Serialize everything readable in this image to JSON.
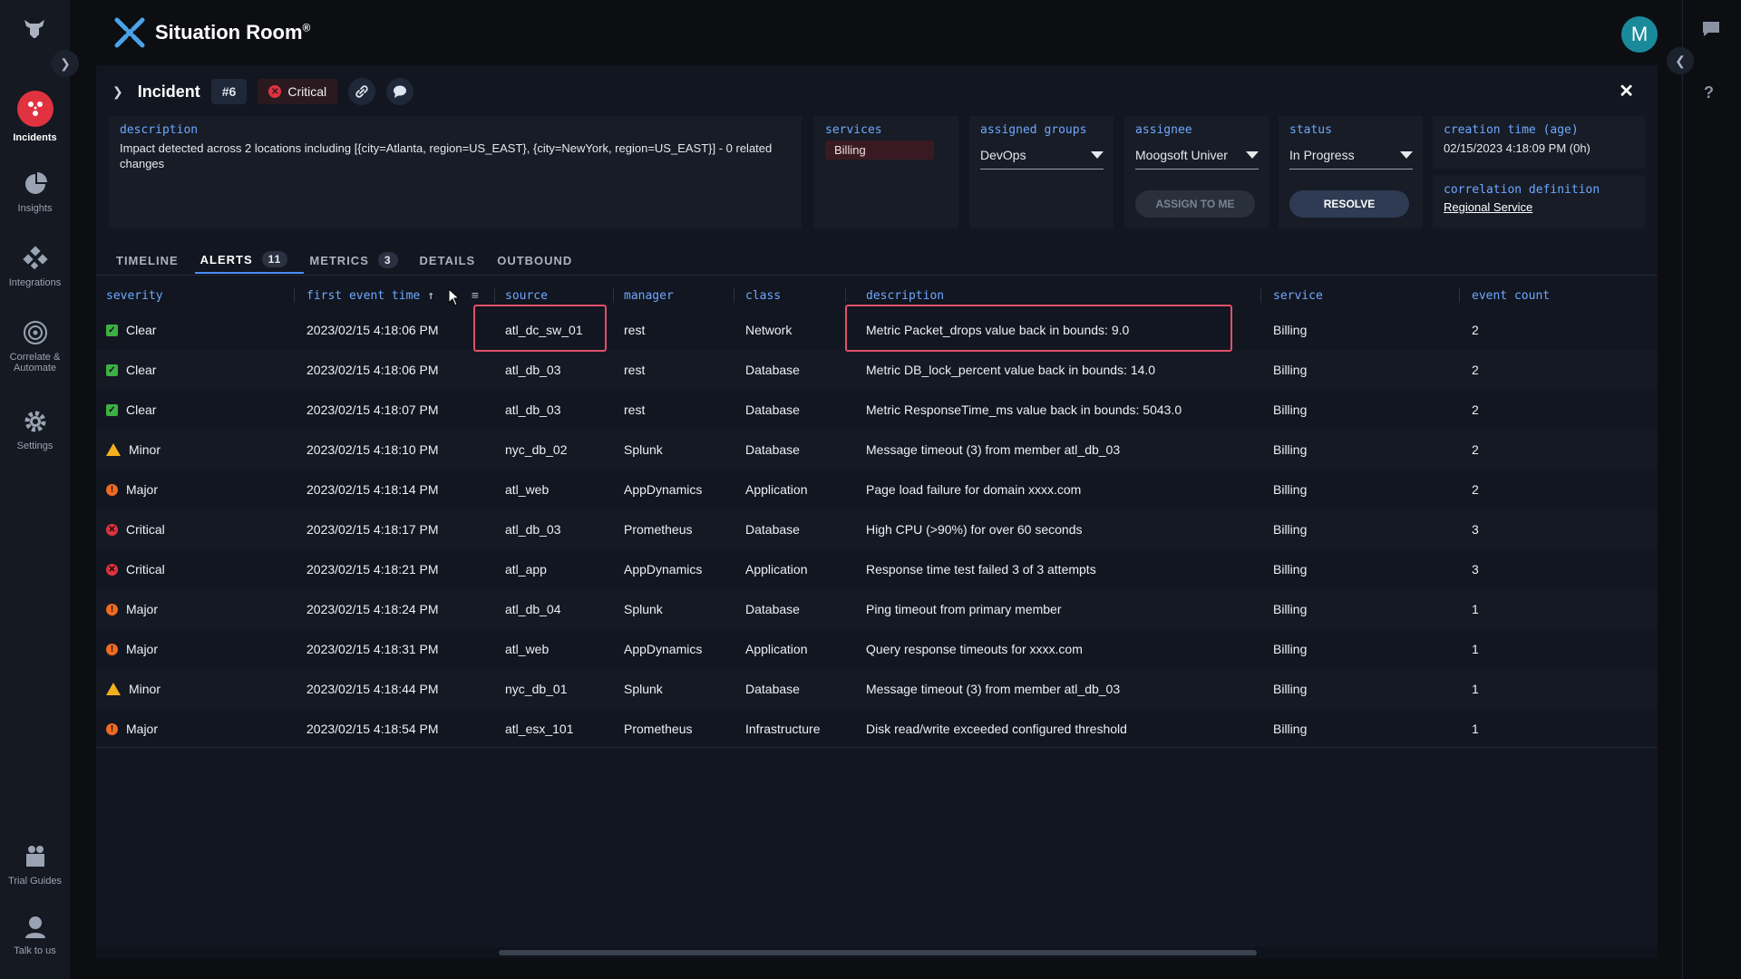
{
  "app": {
    "title": "Situation Room",
    "title_mark": "®",
    "avatar_initial": "M"
  },
  "nav": [
    {
      "label": "Incidents",
      "icon": "incidents-icon",
      "active": true
    },
    {
      "label": "Insights",
      "icon": "insights-icon"
    },
    {
      "label": "Integrations",
      "icon": "integrations-icon"
    },
    {
      "label": "Correlate & Automate",
      "icon": "correlate-icon"
    },
    {
      "label": "Settings",
      "icon": "settings-icon"
    },
    {
      "label": "Trial Guides",
      "icon": "trial-guides-icon"
    },
    {
      "label": "Talk to us",
      "icon": "talk-to-us-icon"
    }
  ],
  "incident": {
    "label": "Incident",
    "number": "#6",
    "severity": "Critical",
    "description_label": "description",
    "description": "Impact detected across 2 locations including [{city=Atlanta, region=US_EAST}, {city=NewYork, region=US_EAST}] - 0 related changes",
    "services_label": "services",
    "service": "Billing",
    "assigned_groups_label": "assigned groups",
    "assigned_group": "DevOps",
    "assignee_label": "assignee",
    "assignee": "Moogsoft Univer",
    "assign_to_me": "ASSIGN TO ME",
    "status_label": "status",
    "status": "In Progress",
    "resolve": "RESOLVE",
    "creation_label": "creation time (age)",
    "creation_time": "02/15/2023 4:18:09 PM (0h)",
    "correlation_label": "correlation definition",
    "correlation": "Regional Service"
  },
  "tabs": [
    {
      "label": "TIMELINE"
    },
    {
      "label": "ALERTS",
      "count": "11",
      "active": true
    },
    {
      "label": "METRICS",
      "count": "3"
    },
    {
      "label": "DETAILS"
    },
    {
      "label": "OUTBOUND"
    }
  ],
  "columns": {
    "severity": "severity",
    "first_event_time": "first event time",
    "sort_indicator": "↑",
    "source": "source",
    "manager": "manager",
    "class": "class",
    "description": "description",
    "service": "service",
    "event_count": "event count"
  },
  "rows": [
    {
      "severity": "Clear",
      "time": "2023/02/15 4:18:06 PM",
      "source": "atl_dc_sw_01",
      "manager": "rest",
      "class": "Network",
      "description": "Metric Packet_drops value back in bounds: 9.0",
      "service": "Billing",
      "count": "2"
    },
    {
      "severity": "Clear",
      "time": "2023/02/15 4:18:06 PM",
      "source": "atl_db_03",
      "manager": "rest",
      "class": "Database",
      "description": "Metric DB_lock_percent value back in bounds: 14.0",
      "service": "Billing",
      "count": "2"
    },
    {
      "severity": "Clear",
      "time": "2023/02/15 4:18:07 PM",
      "source": "atl_db_03",
      "manager": "rest",
      "class": "Database",
      "description": "Metric ResponseTime_ms value back in bounds: 5043.0",
      "service": "Billing",
      "count": "2"
    },
    {
      "severity": "Minor",
      "time": "2023/02/15 4:18:10 PM",
      "source": "nyc_db_02",
      "manager": "Splunk",
      "class": "Database",
      "description": "Message timeout (3) from member atl_db_03",
      "service": "Billing",
      "count": "2"
    },
    {
      "severity": "Major",
      "time": "2023/02/15 4:18:14 PM",
      "source": "atl_web",
      "manager": "AppDynamics",
      "class": "Application",
      "description": "Page load failure for domain xxxx.com",
      "service": "Billing",
      "count": "2"
    },
    {
      "severity": "Critical",
      "time": "2023/02/15 4:18:17 PM",
      "source": "atl_db_03",
      "manager": "Prometheus",
      "class": "Database",
      "description": "High CPU (>90%) for over 60 seconds",
      "service": "Billing",
      "count": "3"
    },
    {
      "severity": "Critical",
      "time": "2023/02/15 4:18:21 PM",
      "source": "atl_app",
      "manager": "AppDynamics",
      "class": "Application",
      "description": "Response time test failed 3 of 3 attempts",
      "service": "Billing",
      "count": "3"
    },
    {
      "severity": "Major",
      "time": "2023/02/15 4:18:24 PM",
      "source": "atl_db_04",
      "manager": "Splunk",
      "class": "Database",
      "description": "Ping timeout from primary member",
      "service": "Billing",
      "count": "1"
    },
    {
      "severity": "Major",
      "time": "2023/02/15 4:18:31 PM",
      "source": "atl_web",
      "manager": "AppDynamics",
      "class": "Application",
      "description": "Query response timeouts for xxxx.com",
      "service": "Billing",
      "count": "1"
    },
    {
      "severity": "Minor",
      "time": "2023/02/15 4:18:44 PM",
      "source": "nyc_db_01",
      "manager": "Splunk",
      "class": "Database",
      "description": "Message timeout (3) from member atl_db_03",
      "service": "Billing",
      "count": "1"
    },
    {
      "severity": "Major",
      "time": "2023/02/15 4:18:54 PM",
      "source": "atl_esx_101",
      "manager": "Prometheus",
      "class": "Infrastructure",
      "description": "Disk read/write exceeded configured threshold",
      "service": "Billing",
      "count": "1"
    }
  ],
  "colors": {
    "critical": "#e0323f",
    "major": "#f06a21",
    "minor": "#f2b01e",
    "clear": "#3cb043",
    "accent": "#6ea8ff",
    "highlight": "#e0506a"
  }
}
